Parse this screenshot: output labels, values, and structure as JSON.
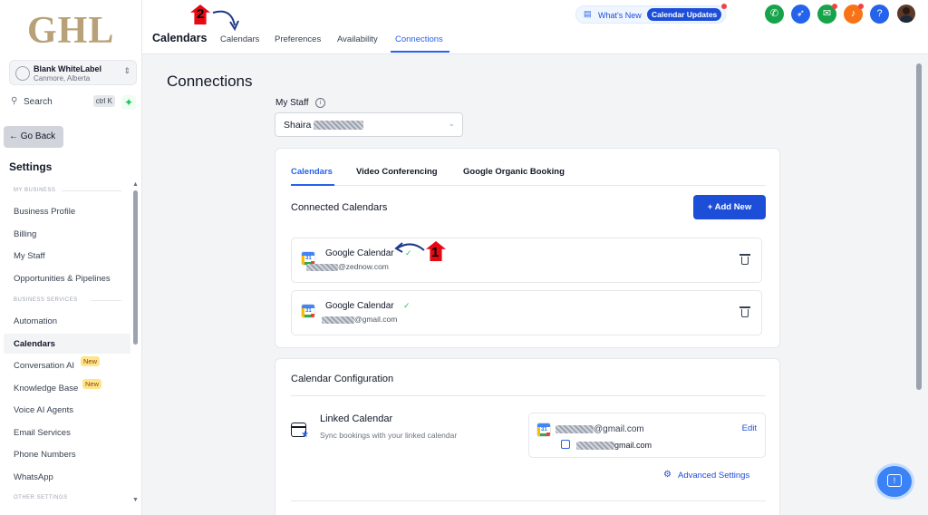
{
  "sidebar": {
    "logo": "GHL",
    "location": {
      "name": "Blank WhiteLabel",
      "sub": "Canmore, Alberta"
    },
    "search": {
      "label": "Search",
      "shortcut": "ctrl K"
    },
    "go_back": "← Go Back",
    "title": "Settings",
    "sections": {
      "my_business": "MY BUSINESS",
      "business_services": "BUSINESS SERVICES",
      "other_settings": "OTHER SETTINGS"
    },
    "items": [
      {
        "label": "Business Profile"
      },
      {
        "label": "Billing"
      },
      {
        "label": "My Staff"
      },
      {
        "label": "Opportunities & Pipelines"
      },
      {
        "label": "Automation"
      },
      {
        "label": "Calendars"
      },
      {
        "label": "Conversation AI",
        "badge": "New"
      },
      {
        "label": "Knowledge Base",
        "badge": "New"
      },
      {
        "label": "Voice AI Agents"
      },
      {
        "label": "Email Services"
      },
      {
        "label": "Phone Numbers"
      },
      {
        "label": "WhatsApp"
      }
    ]
  },
  "header": {
    "title": "Calendars",
    "tabs": [
      {
        "label": "Calendars"
      },
      {
        "label": "Preferences"
      },
      {
        "label": "Availability"
      },
      {
        "label": "Connections"
      }
    ],
    "whats_new": "What's New",
    "updates_pill": "Calendar Updates"
  },
  "main": {
    "title": "Connections",
    "staff_label": "My Staff",
    "staff_value": "Shaira",
    "card_tabs": [
      {
        "label": "Calendars"
      },
      {
        "label": "Video Conferencing"
      },
      {
        "label": "Google Organic Booking"
      }
    ],
    "connected_title": "Connected Calendars",
    "add_new": "+ Add New",
    "calendars": [
      {
        "name": "Google Calendar",
        "email": "@zednow.com"
      },
      {
        "name": "Google Calendar",
        "email": "@gmail.com"
      }
    ],
    "config_title": "Calendar Configuration",
    "linked": {
      "title": "Linked Calendar",
      "sub": "Sync bookings with your linked calendar",
      "email1": "@gmail.com",
      "email2": "gmail.com",
      "edit": "Edit"
    },
    "advanced": "Advanced Settings",
    "annotations": {
      "one": "1",
      "two": "2"
    }
  },
  "colors": {
    "accent": "#2563eb",
    "brand": "#b8a178",
    "annotation": "#e50914"
  },
  "icons": [
    "phone-icon",
    "rocket-icon",
    "megaphone-icon",
    "bell-icon",
    "help-icon",
    "chat-icon",
    "trash-icon",
    "gear-icon",
    "info-icon",
    "check-icon"
  ]
}
